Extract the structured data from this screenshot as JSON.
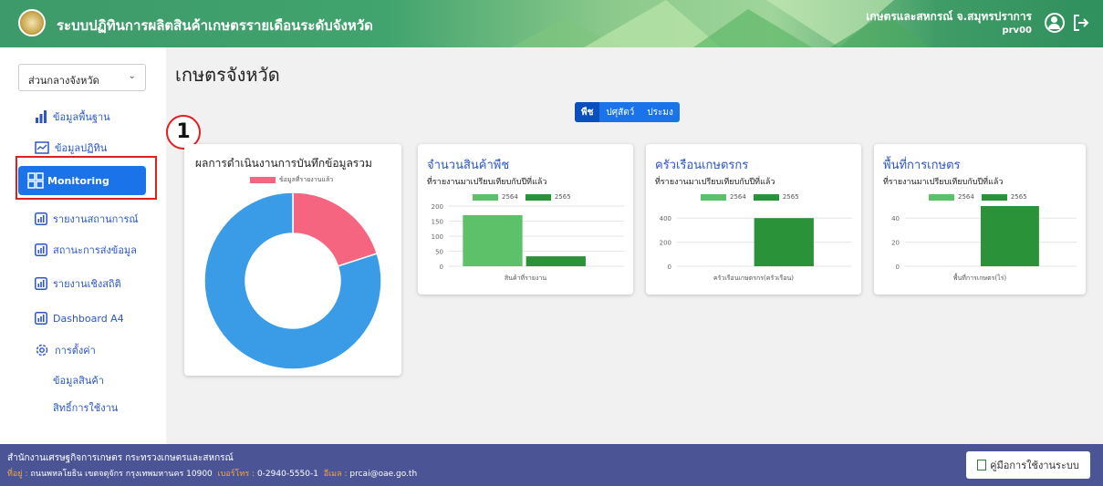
{
  "header": {
    "app_title": "ระบบปฏิทินการผลิตสินค้าเกษตรรายเดือนระดับจังหวัด",
    "user_org": "เกษตรและสหกรณ์ จ.สมุทรปราการ",
    "user_id": "prv00"
  },
  "sidebar": {
    "region_select": "ส่วนกลางจังหวัด",
    "items": [
      {
        "label": "ข้อมูลพื้นฐาน"
      },
      {
        "label": "ข้อมูลปฏิทิน"
      },
      {
        "label": "Monitoring"
      },
      {
        "label": "รายงานสถานการณ์"
      },
      {
        "label": "สถานะการส่งข้อมูล"
      },
      {
        "label": "รายงานเชิงสถิติ"
      },
      {
        "label": "Dashboard A4"
      },
      {
        "label": "การตั้งค่า"
      }
    ],
    "sub_items": [
      {
        "label": "ข้อมูลสินค้า"
      },
      {
        "label": "สิทธิ์การใช้งาน"
      }
    ],
    "callout_number": "1"
  },
  "main": {
    "page_title": "เกษตรจังหวัด",
    "tabs": [
      {
        "label": "พืช"
      },
      {
        "label": "ปศุสัตว์"
      },
      {
        "label": "ประมง"
      }
    ],
    "donut_card": {
      "title": "ผลการดำเนินงานการบันทึกข้อมูลรวม",
      "legend": "ข้อมูลที่รายงานแล้ว"
    },
    "cards": [
      {
        "title": "จำนวนสินค้าพืช",
        "subtitle": "ที่รายงานมาเปรียบเทียบกับปีที่แล้ว",
        "xlabel": "สินค้าที่รายงาน"
      },
      {
        "title": "ครัวเรือนเกษตรกร",
        "subtitle": "ที่รายงานมาเปรียบเทียบกับปีที่แล้ว",
        "xlabel": "ครัวเรือนเกษตรกร(ครัวเรือน)"
      },
      {
        "title": "พื้นที่การเกษตร",
        "subtitle": "ที่รายงานมาเปรียบเทียบกับปีที่แล้ว",
        "xlabel": "พื้นที่การเกษตร(ไร่)"
      }
    ],
    "legend_labels": [
      "2564",
      "2565"
    ]
  },
  "chart_data": [
    {
      "type": "pie",
      "title": "ผลการดำเนินงานการบันทึกข้อมูลรวม",
      "categories": [
        "ข้อมูลที่รายงานแล้ว",
        ""
      ],
      "values": [
        20,
        80
      ],
      "colors": [
        "#f6657f",
        "#3a9be6"
      ]
    },
    {
      "type": "bar",
      "title": "จำนวนสินค้าพืช",
      "categories": [
        "สินค้าที่รายงาน"
      ],
      "series": [
        {
          "name": "2564",
          "values": [
            170
          ]
        },
        {
          "name": "2565",
          "values": [
            33
          ]
        }
      ],
      "ylim": [
        0,
        200
      ],
      "yticks": [
        0,
        50,
        100,
        150,
        200
      ],
      "colors": [
        "#5cc168",
        "#2a9339"
      ]
    },
    {
      "type": "bar",
      "title": "ครัวเรือนเกษตรกร",
      "categories": [
        "ครัวเรือนเกษตรกร(ครัวเรือน)"
      ],
      "series": [
        {
          "name": "2564",
          "values": [
            0
          ]
        },
        {
          "name": "2565",
          "values": [
            400
          ]
        }
      ],
      "ylim": [
        0,
        500
      ],
      "yticks": [
        0,
        200,
        400
      ],
      "colors": [
        "#5cc168",
        "#2a9339"
      ]
    },
    {
      "type": "bar",
      "title": "พื้นที่การเกษตร",
      "categories": [
        "พื้นที่การเกษตร(ไร่)"
      ],
      "series": [
        {
          "name": "2564",
          "values": [
            0
          ]
        },
        {
          "name": "2565",
          "values": [
            50
          ]
        }
      ],
      "ylim": [
        0,
        50
      ],
      "yticks": [
        0,
        20,
        40
      ],
      "colors": [
        "#5cc168",
        "#2a9339"
      ]
    }
  ],
  "footer": {
    "org": "สำนักงานเศรษฐกิจการเกษตร กระทรวงเกษตรและสหกรณ์",
    "addr_label": "ที่อยู่ :",
    "addr": "ถนนพหลโยธิน เขตจตุจักร กรุงเทพมหานคร 10900",
    "phone_label": "เบอร์โทร :",
    "phone": "0-2940-5550-1",
    "email_label": "อีเมล :",
    "email": "prcai@oae.go.th",
    "manual_button": "คู่มือการใช้งานระบบ"
  },
  "colors": {
    "header_green": "#3d9a6a",
    "primary_blue": "#1a73e8",
    "footer_navy": "#4b5596",
    "highlight_red": "#e02020"
  }
}
